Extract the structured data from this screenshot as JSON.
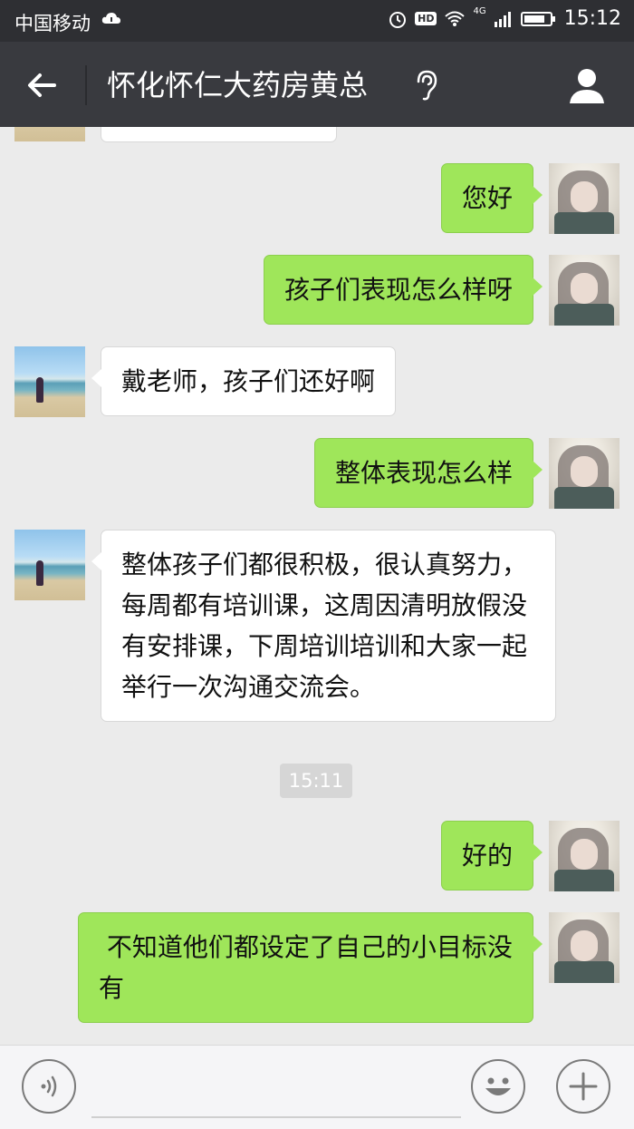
{
  "status_bar": {
    "carrier": "中国移动",
    "hd": "HD",
    "network": "4G",
    "time": "15:12"
  },
  "header": {
    "title": "怀化怀仁大药房黄总",
    "back_icon": "arrow-left-icon",
    "voice_mode_icon": "ear-icon",
    "profile_icon": "person-icon"
  },
  "messages": [
    {
      "side": "out",
      "text": "您好"
    },
    {
      "side": "out",
      "text": "孩子们表现怎么样呀"
    },
    {
      "side": "in",
      "text": "戴老师，孩子们还好啊"
    },
    {
      "side": "out",
      "text": "整体表现怎么样"
    },
    {
      "side": "in",
      "text": "整体孩子们都很积极，很认真努力，每周都有培训课，这周因清明放假没有安排课，下周培训培训和大家一起举行一次沟通交流会。"
    },
    {
      "side": "out",
      "text": "好的"
    },
    {
      "side": "out",
      "text": " 不知道他们都设定了自己的小目标没有"
    }
  ],
  "timestamp": "15:11",
  "input_bar": {
    "voice_icon": "voice-icon",
    "emoji_icon": "emoji-icon",
    "plus_icon": "plus-icon",
    "text_value": ""
  },
  "colors": {
    "status_bar_bg": "#2e2f33",
    "nav_bg": "#393a3f",
    "chat_bg": "#ebebeb",
    "outgoing_bubble": "#9fe65a",
    "incoming_bubble": "#ffffff"
  }
}
